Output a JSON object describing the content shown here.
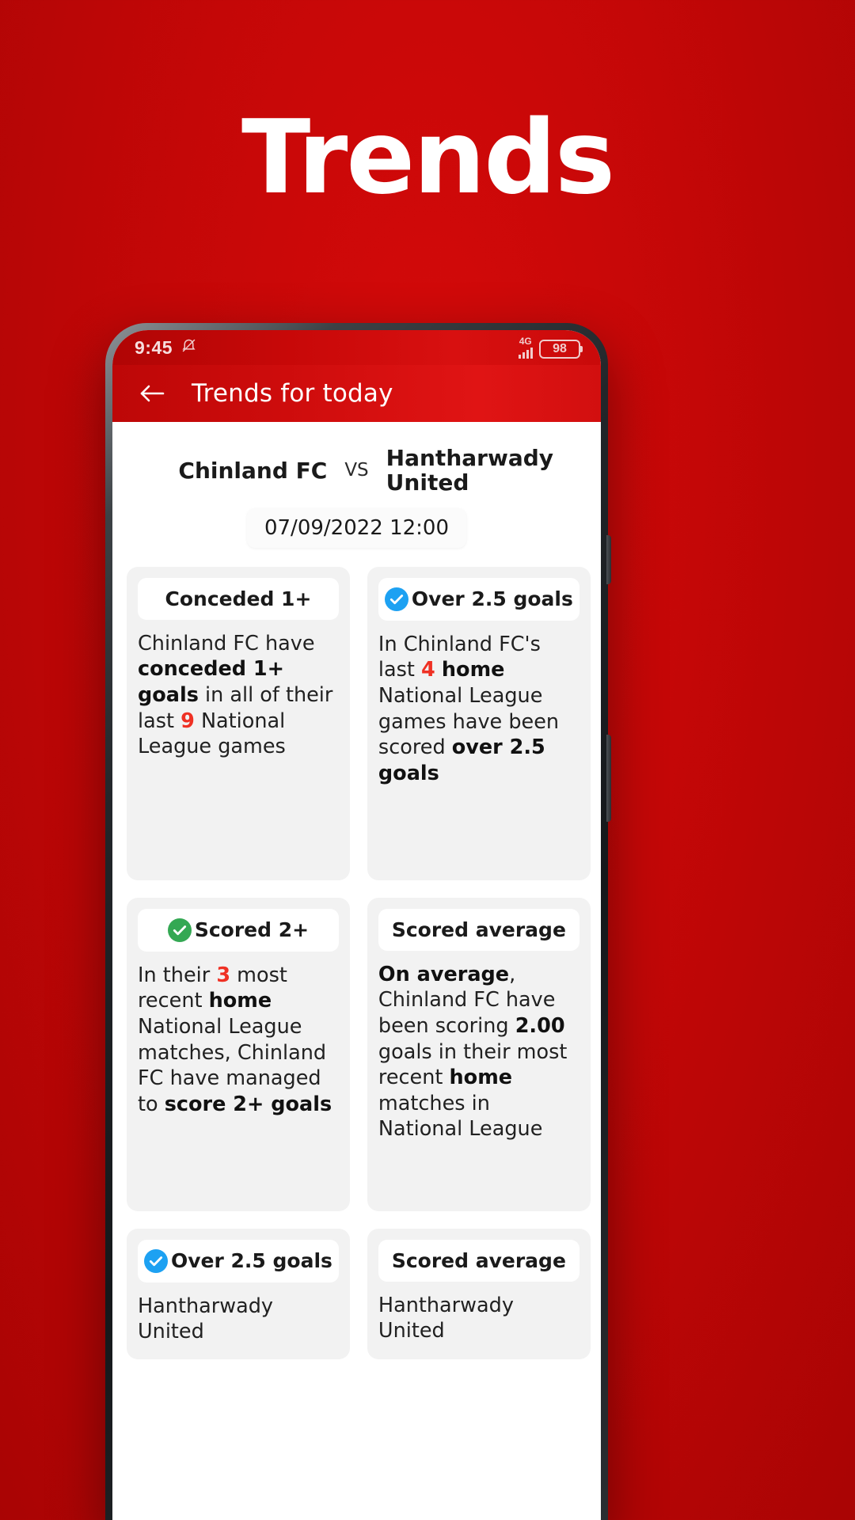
{
  "hero": {
    "title": "Trends"
  },
  "statusbar": {
    "time": "9:45",
    "mute_icon": "bell-muted-icon",
    "network": "4G",
    "battery": "98"
  },
  "appbar": {
    "back_icon": "back-arrow-icon",
    "title": "Trends for today"
  },
  "match": {
    "home_team": "Chinland FC",
    "vs": "VS",
    "away_team": "Hantharwady United",
    "datetime": "07/09/2022 12:00"
  },
  "cards": [
    {
      "title": "Conceded 1+",
      "icon": "none",
      "body_parts": [
        {
          "t": "Chinland FC have ",
          "s": "normal"
        },
        {
          "t": "conceded 1+ goals",
          "s": "bold"
        },
        {
          "t": " in all of their last ",
          "s": "normal"
        },
        {
          "t": "9",
          "s": "num"
        },
        {
          "t": " National League games",
          "s": "normal"
        }
      ]
    },
    {
      "title": "Over 2.5 goals",
      "icon": "check-circle-blue-icon",
      "body_parts": [
        {
          "t": "In Chinland FC's last ",
          "s": "normal"
        },
        {
          "t": "4",
          "s": "num"
        },
        {
          "t": " ",
          "s": "normal"
        },
        {
          "t": "home",
          "s": "bold"
        },
        {
          "t": " National League games have been scored ",
          "s": "normal"
        },
        {
          "t": "over 2.5 goals",
          "s": "bold"
        }
      ]
    },
    {
      "title": "Scored 2+",
      "icon": "check-circle-green-icon",
      "body_parts": [
        {
          "t": "In their ",
          "s": "normal"
        },
        {
          "t": "3",
          "s": "num"
        },
        {
          "t": " most recent ",
          "s": "normal"
        },
        {
          "t": "home",
          "s": "bold"
        },
        {
          "t": " National League matches, Chinland FC have managed to ",
          "s": "normal"
        },
        {
          "t": "score 2+ goals",
          "s": "bold"
        }
      ]
    },
    {
      "title": "Scored average",
      "icon": "none",
      "body_parts": [
        {
          "t": "On average",
          "s": "bold"
        },
        {
          "t": ", Chinland FC have been scoring ",
          "s": "normal"
        },
        {
          "t": "2.00",
          "s": "bold"
        },
        {
          "t": " goals in their most recent ",
          "s": "normal"
        },
        {
          "t": "home",
          "s": "bold"
        },
        {
          "t": " matches in National League",
          "s": "normal"
        }
      ]
    },
    {
      "title": "Over 2.5 goals",
      "icon": "check-circle-blue-icon",
      "body_parts": [
        {
          "t": "Hantharwady United",
          "s": "normal"
        }
      ]
    },
    {
      "title": "Scored average",
      "icon": "none",
      "body_parts": [
        {
          "t": "Hantharwady United",
          "s": "normal"
        }
      ]
    }
  ],
  "colors": {
    "brand_red": "#c40707",
    "appbar_red": "#d00d0d",
    "accent_number_red": "#ef3124",
    "tick_blue": "#1da1f2",
    "tick_green": "#34a853",
    "card_bg": "#f2f2f2"
  }
}
